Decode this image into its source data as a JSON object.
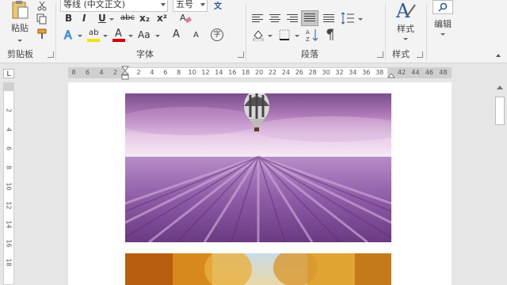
{
  "ribbon": {
    "clipboard": {
      "paste_label": "粘贴",
      "group_label": "剪贴板"
    },
    "font": {
      "font_name": "等线 (中文正文)",
      "font_size": "五号",
      "group_label": "字体",
      "bold": "B",
      "italic": "I",
      "underline": "U",
      "strike": "abc",
      "subscript": "x₂",
      "superscript": "x²",
      "highlight_glyph": "ab",
      "font_color_glyph": "A",
      "change_case": "Aa",
      "grow": "A",
      "shrink": "A",
      "wen": "文",
      "phonetic": "字"
    },
    "paragraph": {
      "group_label": "段落"
    },
    "styles": {
      "label": "样式",
      "group_label": "样式"
    },
    "editing": {
      "label": "编辑"
    }
  },
  "ruler": {
    "corner": "L",
    "left_ticks": [
      "8",
      "6",
      "4",
      "2"
    ],
    "right_ticks": [
      "2",
      "4",
      "6",
      "8",
      "10",
      "12",
      "14",
      "16",
      "18",
      "20",
      "22",
      "24",
      "26",
      "28",
      "30",
      "32",
      "34",
      "36",
      "38"
    ],
    "end_ticks": [
      "42",
      "44",
      "46",
      "48"
    ],
    "vertical_ticks": [
      "2",
      "4",
      "6",
      "8",
      "10",
      "12",
      "14",
      "16",
      "18"
    ]
  },
  "colors": {
    "highlight": "#f5e100",
    "font_color": "#d20000",
    "accent": "#2b579a"
  },
  "document": {
    "images": [
      "lavender-field-balloon",
      "autumn-trees"
    ]
  }
}
